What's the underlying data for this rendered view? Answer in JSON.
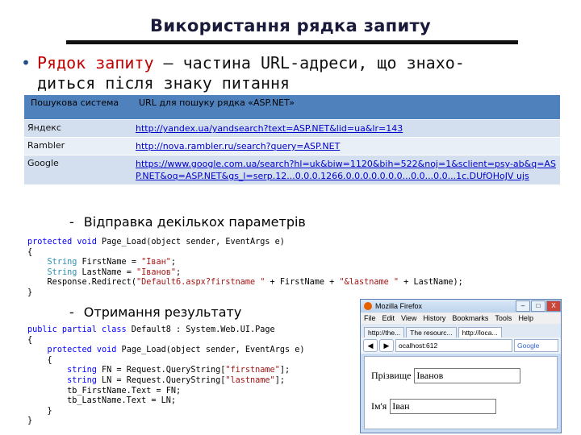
{
  "slide": {
    "title": "Використання рядка запиту",
    "bullet_term": "Рядок запиту",
    "bullet_line1_rest": " – частина URL-адреси, що знахо-",
    "bullet_line2": "диться після знаку питання"
  },
  "table": {
    "headers": [
      "Пошукова система",
      "URL для пошуку рядка «ASP.NET»"
    ],
    "rows": [
      {
        "engine": "Яндекс",
        "url": "http://yandex.ua/yandsearch?text=ASP.NET&lid=ua&lr=143"
      },
      {
        "engine": "Rambler",
        "url": "http://nova.rambler.ru/search?query=ASP.NET"
      },
      {
        "engine": "Google",
        "url": "https://www.google.com.ua/search?hl=uk&biw=1120&bih=522&noj=1&sclient=psy-ab&q=ASP.NET&oq=ASP.NET&gs_l=serp.12...0.0.0.1266.0.0.0.0.0.0.0...0.0...0.0...1c.DUfOHoJV ujs"
      }
    ]
  },
  "section1": {
    "dash": "-",
    "label": "Відправка декількох параметрів"
  },
  "code1": {
    "l1_kw": "protected void",
    "l1_rest": " Page_Load(object sender, EventArgs e)",
    "l2": "{",
    "l3_ty": "String",
    "l3_mid": " FirstName = ",
    "l3_str": "\"Іван\"",
    "l3_end": ";",
    "l4_ty": "String",
    "l4_mid": " LastName = ",
    "l4_str": "\"Іванов\"",
    "l4_end": ";",
    "l5_a": "Response.Redirect(",
    "l5_s1": "\"Default6.aspx?firstname \"",
    "l5_b": " + FirstName + ",
    "l5_s2": "\"&lastname \"",
    "l5_c": " + LastName);",
    "l6": "}"
  },
  "section2": {
    "dash": "-",
    "label": "Отримання результату"
  },
  "code2": {
    "l1_kw": "public partial class",
    "l1_rest": " Default8 : System.Web.UI.Page",
    "l2": "{",
    "l3_kw": "protected void",
    "l3_rest": " Page_Load(object sender, EventArgs e)",
    "l4": "{",
    "l5_kw": "string",
    "l5_mid": " FN = Request.QueryString[",
    "l5_str": "\"firstname\"",
    "l5_end": "];",
    "l6_kw": "string",
    "l6_mid": " LN = Request.QueryString[",
    "l6_str": "\"lastname\"",
    "l6_end": "];",
    "l7": "tb_FirstName.Text = FN;",
    "l8": "tb_LastName.Text = LN;",
    "l9": "}",
    "l10": "}"
  },
  "browser": {
    "title": "Mozilla Firefox",
    "controls": [
      "–",
      "□",
      "X"
    ],
    "menu": [
      "File",
      "Edit",
      "View",
      "History",
      "Bookmarks",
      "Tools",
      "Help"
    ],
    "tabs": [
      "http://the...",
      "The resourc...",
      "http://loca..."
    ],
    "url": "ocalhost:612",
    "search_placeholder": "Google",
    "fields": [
      {
        "label": "Прізвище",
        "value": "Іванов"
      },
      {
        "label": "Ім'я",
        "value": "Іван"
      }
    ]
  }
}
